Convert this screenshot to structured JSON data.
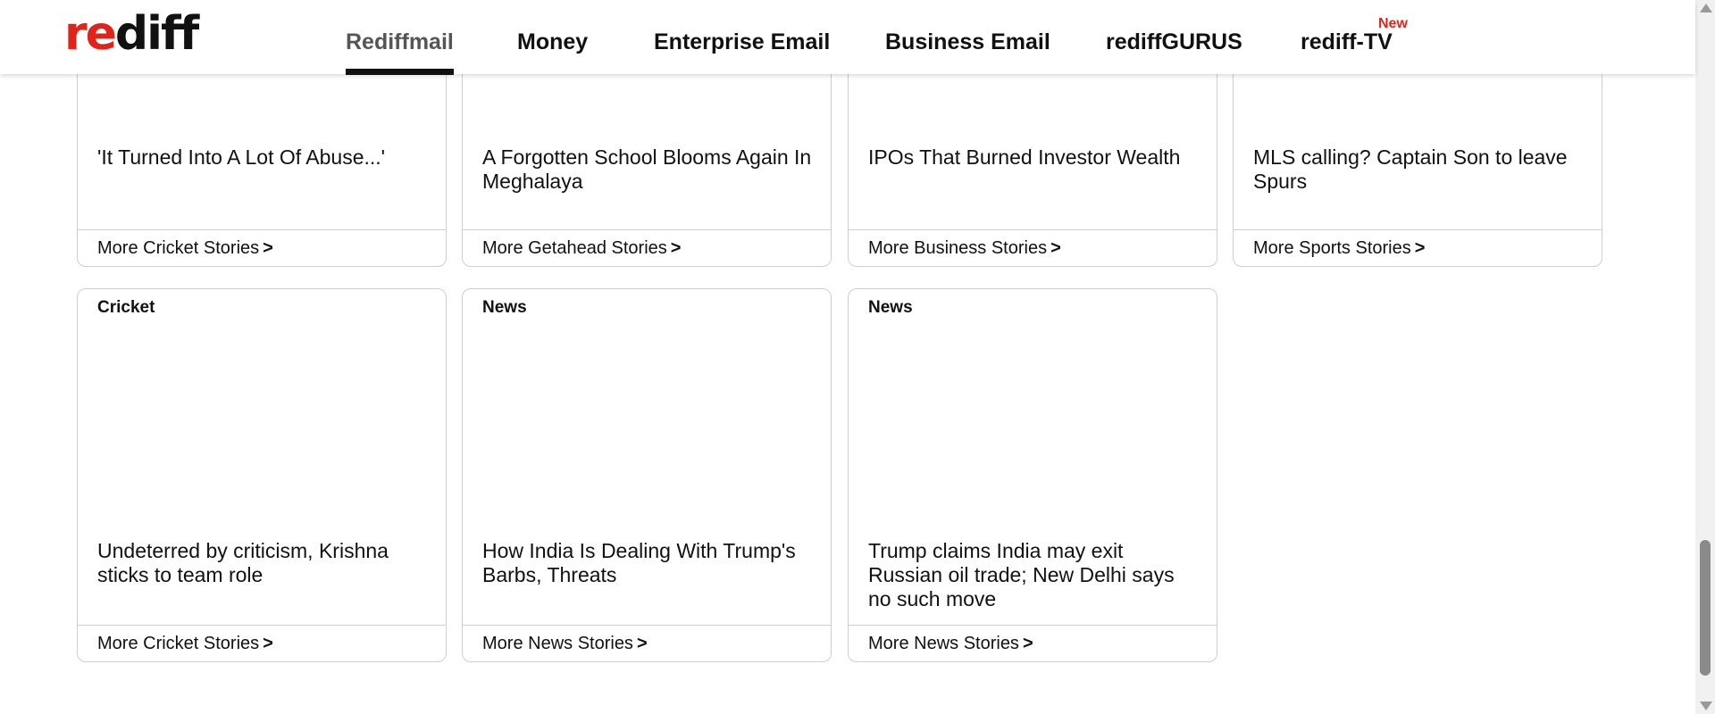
{
  "header": {
    "logo": {
      "part1": "re",
      "part2": "diff"
    },
    "nav": [
      {
        "label": "Rediffmail",
        "active": true
      },
      {
        "label": "Money"
      },
      {
        "label": "Enterprise Email"
      },
      {
        "label": "Business Email"
      },
      {
        "label": "rediffGURUS"
      },
      {
        "label": "rediff-TV",
        "badge": "New"
      }
    ]
  },
  "cards_top": [
    {
      "headline": "'It Turned Into A Lot Of Abuse...'",
      "more": "More Cricket Stories"
    },
    {
      "headline": "A Forgotten School Blooms Again In Meghalaya",
      "more": "More Getahead Stories"
    },
    {
      "headline": "IPOs That Burned Investor Wealth",
      "more": "More Business Stories"
    },
    {
      "headline": "MLS calling? Captain Son to leave Spurs",
      "more": "More Sports Stories"
    }
  ],
  "cards_bottom": [
    {
      "category": "Cricket",
      "headline": "Undeterred by criticism, Krishna sticks to team role",
      "more": "More Cricket Stories"
    },
    {
      "category": "News",
      "headline": "How India Is Dealing With Trump's Barbs, Threats",
      "more": "More News Stories"
    },
    {
      "category": "News",
      "headline": "Trump claims India may exit Russian oil trade; New Delhi says no such move",
      "more": "More News Stories"
    }
  ],
  "more_arrow": ">",
  "colors": {
    "brand_red": "#e2231a",
    "text": "#111111",
    "border": "#cfcfcf"
  }
}
